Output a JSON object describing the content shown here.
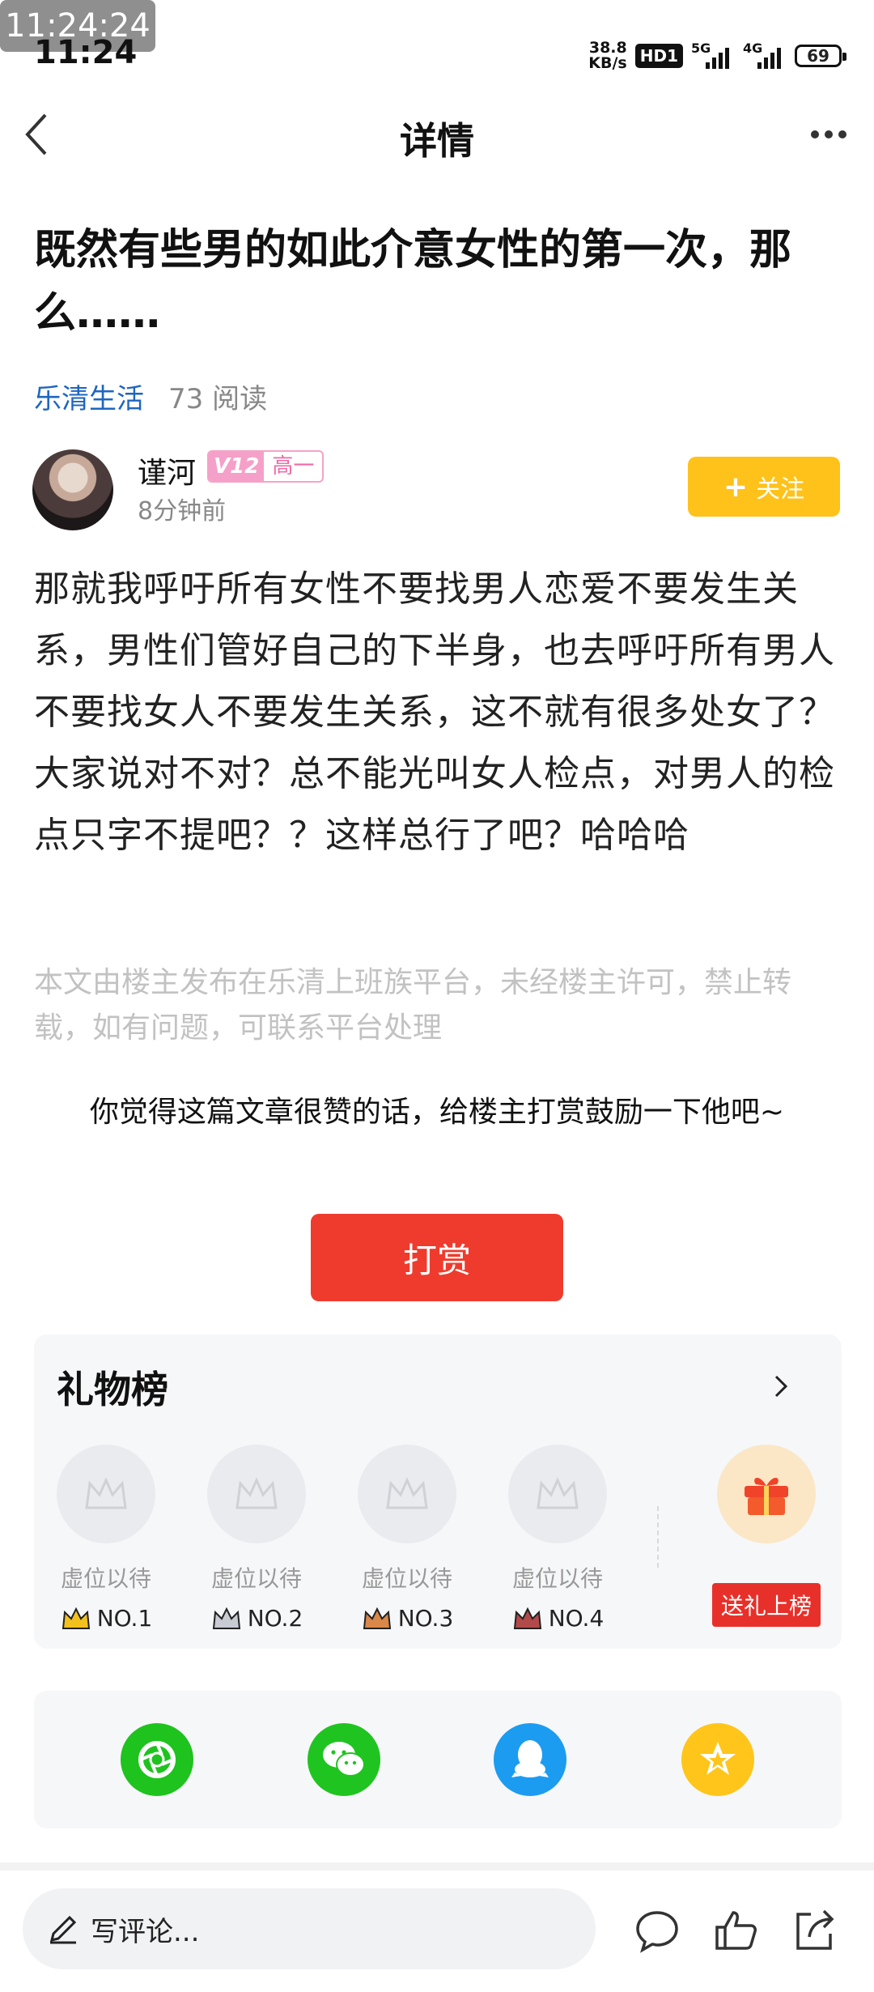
{
  "status_bar": {
    "overlay_time": "11:24:24",
    "time": "11:24",
    "net_speed": "38.8",
    "net_unit": "KB/s",
    "hd": "HD1",
    "signal_1": "5G",
    "signal_2": "4G",
    "battery": "69"
  },
  "header": {
    "title": "详情"
  },
  "article": {
    "title": "既然有些男的如此介意女性的第一次，那么……",
    "channel": "乐清生活",
    "reads": "73 阅读",
    "body": "那就我呼吁所有女性不要找男人恋爱不要发生关系，男性们管好自己的下半身，也去呼吁所有男人不要找女人不要发生关系，这不就有很多处女了？大家说对不对？总不能光叫女人检点，对男人的检点只字不提吧？？这样总行了吧？哈哈哈",
    "copyright": "本文由楼主发布在乐清上班族平台，未经楼主许可，禁止转载，如有问题，可联系平台处理"
  },
  "author": {
    "name": "谨河",
    "vip": "V12",
    "grade": "高一",
    "time": "8分钟前",
    "follow_label": "关注"
  },
  "reward": {
    "prompt": "你觉得这篇文章很赞的话，给楼主打赏鼓励一下他吧~",
    "button": "打赏"
  },
  "gift_board": {
    "title": "礼物榜",
    "slots": [
      {
        "vacancy": "虚位以待",
        "rank": "NO.1",
        "crown_color": "#f3c11e"
      },
      {
        "vacancy": "虚位以待",
        "rank": "NO.2",
        "crown_color": "#c9cbd3"
      },
      {
        "vacancy": "虚位以待",
        "rank": "NO.3",
        "crown_color": "#d9884a"
      },
      {
        "vacancy": "虚位以待",
        "rank": "NO.4",
        "crown_color": "#b34a4a"
      }
    ],
    "send_button": "送礼上榜"
  },
  "share": [
    {
      "icon": "moments-icon",
      "color": "#1ec31e"
    },
    {
      "icon": "wechat-icon",
      "color": "#20c420"
    },
    {
      "icon": "qq-icon",
      "color": "#1c9cf0"
    },
    {
      "icon": "favorite-star-icon",
      "color": "#ffc51a"
    }
  ],
  "bottom_bar": {
    "comment_placeholder": "写评论..."
  }
}
